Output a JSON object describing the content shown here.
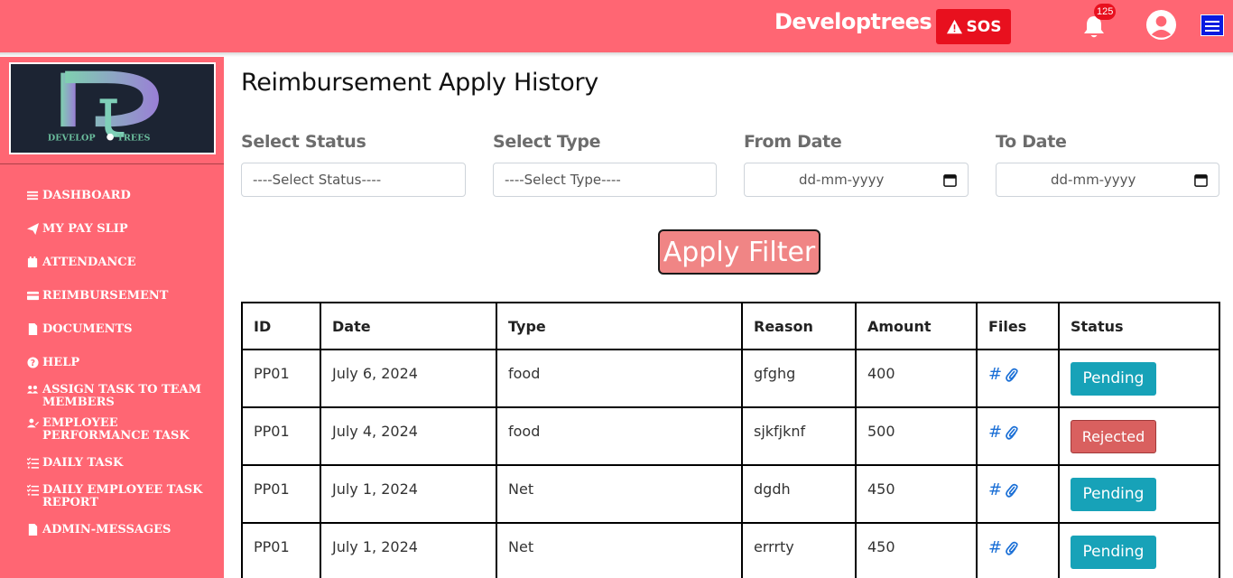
{
  "topbar": {
    "brand": "Developtrees",
    "sos_label": "SOS",
    "notification_count": "125"
  },
  "sidebar": {
    "logo_text": "DEVELOPTREES",
    "items": [
      {
        "label": "DASHBOARD",
        "icon": "bars-icon"
      },
      {
        "label": "MY PAY SLIP",
        "icon": "paper-plane-icon"
      },
      {
        "label": "ATTENDANCE",
        "icon": "calendar-icon"
      },
      {
        "label": "REIMBURSEMENT",
        "icon": "credit-card-icon"
      },
      {
        "label": "DOCUMENTS",
        "icon": "file-icon"
      },
      {
        "label": "HELP",
        "icon": "question-circle-icon"
      },
      {
        "label": "ASSIGN TASK TO TEAM MEMBERS",
        "icon": "users-icon"
      },
      {
        "label": "EMPLOYEE PERFORMANCE TASK",
        "icon": "user-edit-icon"
      },
      {
        "label": "DAILY TASK",
        "icon": "list-check-icon"
      },
      {
        "label": "DAILY EMPLOYEE TASK REPORT",
        "icon": "list-check-icon"
      },
      {
        "label": "ADMIN-MESSAGES",
        "icon": "file-icon"
      }
    ]
  },
  "main": {
    "title": "Reimbursement Apply History",
    "filters": {
      "status_label": "Select Status",
      "status_value": "----Select Status----",
      "type_label": "Select Type",
      "type_value": "----Select Type----",
      "from_label": "From Date",
      "from_placeholder": "dd-mm-yyyy",
      "to_label": "To Date",
      "to_placeholder": "dd-mm-yyyy"
    },
    "apply_label": "Apply Filter",
    "table": {
      "headers": [
        "ID",
        "Date",
        "Type",
        "Reason",
        "Amount",
        "Files",
        "Status"
      ],
      "files_hash": "#",
      "rows": [
        {
          "id": "PP01",
          "date": "July 6, 2024",
          "type": "food",
          "reason": "gfghg",
          "amount": "400",
          "status": "Pending"
        },
        {
          "id": "PP01",
          "date": "July 4, 2024",
          "type": "food",
          "reason": "sjkfjknf",
          "amount": "500",
          "status": "Rejected"
        },
        {
          "id": "PP01",
          "date": "July 1, 2024",
          "type": "Net",
          "reason": "dgdh",
          "amount": "450",
          "status": "Pending"
        },
        {
          "id": "PP01",
          "date": "July 1, 2024",
          "type": "Net",
          "reason": "errrty",
          "amount": "450",
          "status": "Pending"
        }
      ]
    }
  },
  "colors": {
    "primary": "#ff6673",
    "sos": "#e8101e",
    "pending": "#17a2b8",
    "rejected": "#d9605f",
    "apply": "#f08585"
  }
}
